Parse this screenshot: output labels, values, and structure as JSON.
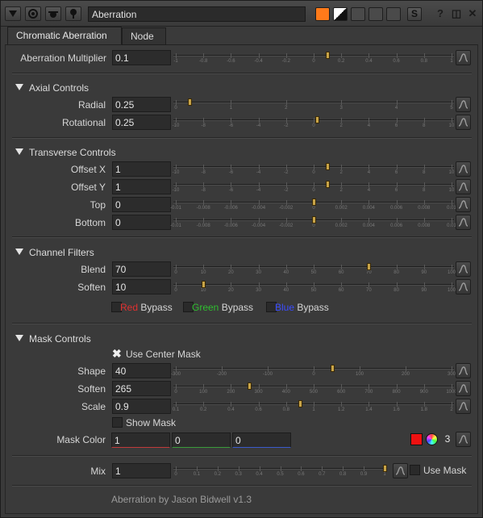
{
  "title": "Aberration",
  "tabs": {
    "main": "Chromatic Aberration",
    "node": "Node"
  },
  "aberration_multiplier": {
    "label": "Aberration Multiplier",
    "value": "0.1",
    "ticks": [
      "-1",
      "-0.8",
      "-0.6",
      "-0.4",
      "-0.2",
      "0",
      "0.2",
      "0.4",
      "0.6",
      "0.8",
      "1"
    ],
    "range": [
      -1,
      1
    ],
    "handle": 0.1
  },
  "axial": {
    "header": "Axial Controls",
    "radial": {
      "label": "Radial",
      "value": "0.25",
      "ticks": [
        "0",
        "1",
        "2",
        "3",
        "4",
        "5"
      ],
      "range": [
        0,
        5
      ],
      "handle": 0.25
    },
    "rotational": {
      "label": "Rotational",
      "value": "0.25",
      "ticks": [
        "-10",
        "-8",
        "-6",
        "-4",
        "-2",
        "0",
        "2",
        "4",
        "6",
        "8",
        "10"
      ],
      "range": [
        -10,
        10
      ],
      "handle": 0.25
    }
  },
  "transverse": {
    "header": "Transverse Controls",
    "offset_x": {
      "label": "Offset X",
      "value": "1",
      "ticks": [
        "-10",
        "-8",
        "-6",
        "-4",
        "-2",
        "0",
        "2",
        "4",
        "6",
        "8",
        "10"
      ],
      "range": [
        -10,
        10
      ],
      "handle": 1
    },
    "offset_y": {
      "label": "Offset  Y",
      "value": "1",
      "ticks": [
        "-10",
        "-8",
        "-6",
        "-4",
        "-2",
        "0",
        "2",
        "4",
        "6",
        "8",
        "10"
      ],
      "range": [
        -10,
        10
      ],
      "handle": 1
    },
    "top": {
      "label": "Top",
      "value": "0",
      "ticks": [
        "-0.01",
        "-0.008",
        "-0.006",
        "-0.004",
        "-0.002",
        "0",
        "0.002",
        "0.004",
        "0.006",
        "0.008",
        "0.01"
      ],
      "range": [
        -0.01,
        0.01
      ],
      "handle": 0
    },
    "bottom": {
      "label": "Bottom",
      "value": "0",
      "ticks": [
        "-0.01",
        "-0.008",
        "-0.006",
        "-0.004",
        "-0.002",
        "0",
        "0.002",
        "0.004",
        "0.006",
        "0.008",
        "0.01"
      ],
      "range": [
        -0.01,
        0.01
      ],
      "handle": 0
    }
  },
  "channel": {
    "header": "Channel Filters",
    "blend": {
      "label": "Blend",
      "value": "70",
      "ticks": [
        "0",
        "10",
        "20",
        "30",
        "40",
        "50",
        "60",
        "70",
        "80",
        "90",
        "100"
      ],
      "range": [
        0,
        100
      ],
      "handle": 70
    },
    "soften": {
      "label": "Soften",
      "value": "10",
      "ticks": [
        "0",
        "10",
        "20",
        "30",
        "40",
        "50",
        "60",
        "70",
        "80",
        "90",
        "100"
      ],
      "range": [
        0,
        100
      ],
      "handle": 10
    },
    "red": {
      "word": "Red",
      "rest": " Bypass",
      "color": "#e03030"
    },
    "green": {
      "word": "Green",
      "rest": " Bypass",
      "color": "#2fbf2f"
    },
    "blue": {
      "word": "Blue",
      "rest": " Bypass",
      "color": "#3a4cff"
    }
  },
  "mask": {
    "header": "Mask Controls",
    "use_center": "Use Center Mask",
    "shape": {
      "label": "Shape",
      "value": "40",
      "ticks": [
        "-300",
        "-200",
        "-100",
        "0",
        "100",
        "200",
        "300"
      ],
      "range": [
        -300,
        300
      ],
      "handle": 40
    },
    "soften": {
      "label": "Soften",
      "value": "265",
      "ticks": [
        "0",
        "100",
        "200",
        "300",
        "400",
        "500",
        "600",
        "700",
        "800",
        "900",
        "1000"
      ],
      "range": [
        0,
        1000
      ],
      "handle": 265
    },
    "scale": {
      "label": "Scale",
      "value": "0.9",
      "ticks": [
        "0.1",
        "0.2",
        "0.4",
        "0.6",
        "0.8",
        "1",
        "1.2",
        "1.4",
        "1.6",
        "1.8",
        "2"
      ],
      "range": [
        0,
        2
      ],
      "handle": 0.9
    },
    "show_mask": "Show Mask",
    "color_label": "Mask Color",
    "color_values": [
      "1",
      "0",
      "0"
    ],
    "channels_count": "3"
  },
  "mix": {
    "label": "Mix",
    "value": "1",
    "ticks": [
      "0",
      "0.1",
      "0.2",
      "0.3",
      "0.4",
      "0.5",
      "0.6",
      "0.7",
      "0.8",
      "0.9",
      "1"
    ],
    "range": [
      0,
      1
    ],
    "handle": 1,
    "use_mask": "Use Mask"
  },
  "footer": "Aberration by Jason Bidwell v1.3"
}
